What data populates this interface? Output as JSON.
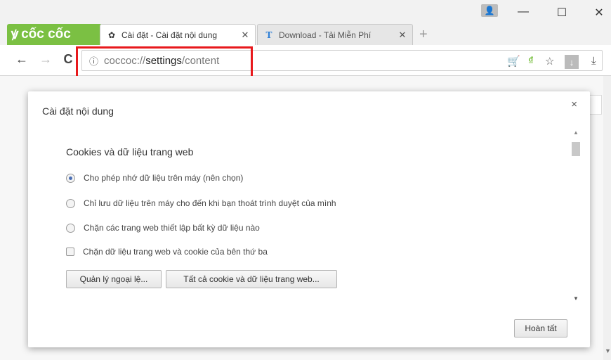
{
  "window": {
    "brand": "cốc cốc",
    "brand_mark": "ꝟ",
    "profile_icon": "👤",
    "minimize": "—",
    "maximize": "☐",
    "close": "✕"
  },
  "tabs": [
    {
      "icon": "✿",
      "title": "Cài đặt - Cài đặt nội dung",
      "close": "✕"
    },
    {
      "icon": "T",
      "title": "Download - Tải Miễn Phí",
      "close": "✕"
    }
  ],
  "new_tab": "+",
  "toolbar": {
    "back": "←",
    "forward": "→",
    "reload": "C",
    "info": "ⓘ",
    "url_scheme": "coccoc://",
    "url_host": "settings",
    "url_path": "/content",
    "cart": "🛒",
    "dong": "₫",
    "star": "☆",
    "download_box": "↓",
    "download": "⤓"
  },
  "colors": {
    "brand_green": "#7bc043",
    "highlight_red": "#e8191c",
    "radio_blue": "#4b6fb5"
  },
  "dialog": {
    "title": "Cài đặt nội dung",
    "close": "×",
    "section_title": "Cookies và dữ liệu trang web",
    "options": [
      {
        "type": "radio",
        "checked": true,
        "label": "Cho phép nhớ dữ liệu trên máy (nên chọn)"
      },
      {
        "type": "radio",
        "checked": false,
        "label": "Chỉ lưu dữ liệu trên máy cho đến khi bạn thoát trình duyệt của mình"
      },
      {
        "type": "radio",
        "checked": false,
        "label": "Chặn các trang web thiết lập bất kỳ dữ liệu nào"
      },
      {
        "type": "checkbox",
        "checked": false,
        "label": "Chặn dữ liệu trang web và cookie của bên thứ ba"
      }
    ],
    "manage_exceptions": "Quản lý ngoại lệ...",
    "all_cookies": "Tất cả cookie và dữ liệu trang web...",
    "done": "Hoàn tất",
    "scroll_up": "▲",
    "scroll_down": "▼"
  }
}
